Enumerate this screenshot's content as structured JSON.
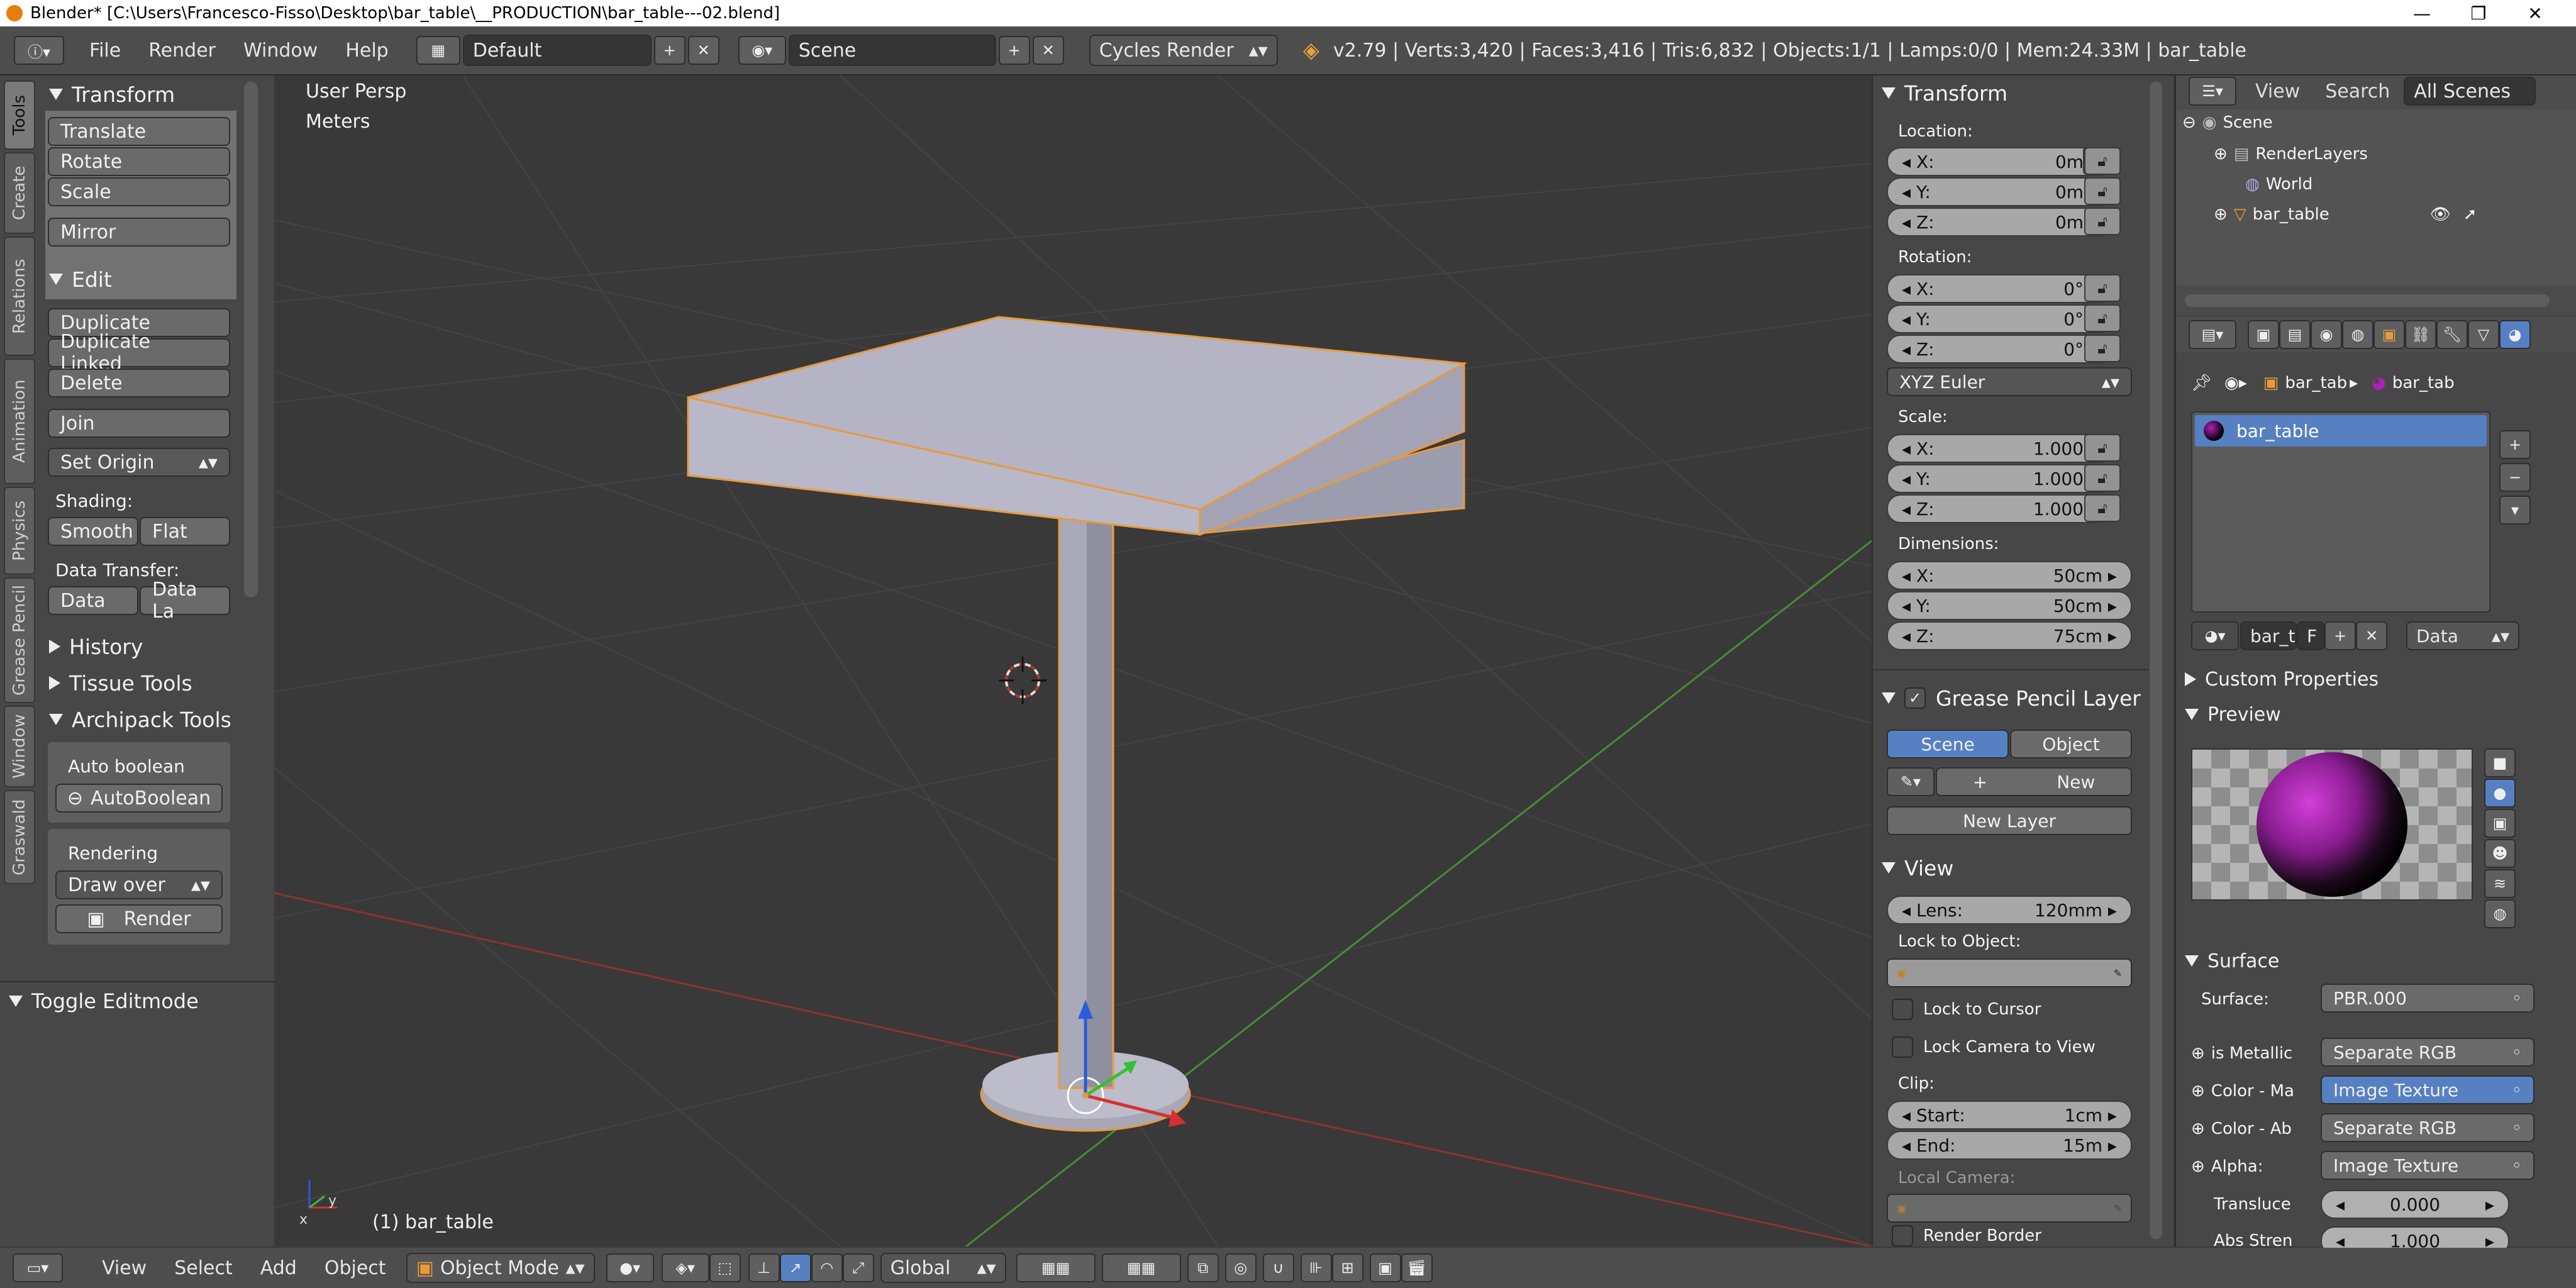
{
  "titlebar": {
    "title": "Blender* [C:\\Users\\Francesco-Fisso\\Desktop\\bar_table\\__PRODUCTION\\bar_table---02.blend]"
  },
  "topbar": {
    "menus": [
      "File",
      "Render",
      "Window",
      "Help"
    ],
    "layout": "Default",
    "scene": "Scene",
    "engine": "Cycles Render",
    "stats": "v2.79 | Verts:3,420 | Faces:3,416 | Tris:6,832 | Objects:1/1 | Lamps:0/0 | Mem:24.33M | bar_table"
  },
  "toolshelf": {
    "tabs": [
      "Tools",
      "Create",
      "Relations",
      "Animation",
      "Physics",
      "Grease Pencil",
      "Window",
      "Graswald"
    ],
    "transform_title": "Transform",
    "translate": "Translate",
    "rotate": "Rotate",
    "scale": "Scale",
    "mirror": "Mirror",
    "edit_title": "Edit",
    "duplicate": "Duplicate",
    "duplicate_linked": "Duplicate Linked",
    "delete": "Delete",
    "join": "Join",
    "set_origin": "Set Origin",
    "shading_label": "Shading:",
    "smooth": "Smooth",
    "flat": "Flat",
    "data_transfer_label": "Data Transfer:",
    "data": "Data",
    "data_la": "Data La",
    "history": "History",
    "tissue_tools": "Tissue Tools",
    "archipack_tools": "Archipack Tools",
    "auto_boolean_label": "Auto boolean",
    "auto_boolean_btn": "AutoBoolean",
    "rendering_label": "Rendering",
    "draw_over": "Draw over",
    "render_btn": "Render",
    "toggle_editmode": "Toggle Editmode"
  },
  "viewport": {
    "view_name": "User Persp",
    "units": "Meters",
    "object_label": "(1) bar_table"
  },
  "properties": {
    "transform_title": "Transform",
    "location_label": "Location:",
    "loc_x": "0m",
    "loc_y": "0m",
    "loc_z": "0m",
    "rotation_label": "Rotation:",
    "rot_x": "0°",
    "rot_y": "0°",
    "rot_z": "0°",
    "rotation_mode": "XYZ Euler",
    "scale_label": "Scale:",
    "scl_x": "1.000",
    "scl_y": "1.000",
    "scl_z": "1.000",
    "dimensions_label": "Dimensions:",
    "dim_x": "50cm",
    "dim_y": "50cm",
    "dim_z": "75cm",
    "axis_x": "X:",
    "axis_y": "Y:",
    "axis_z": "Z:",
    "grease_pencil_title": "Grease Pencil Layer",
    "gp_scene": "Scene",
    "gp_object": "Object",
    "gp_new": "New",
    "gp_new_layer": "New Layer",
    "view_title": "View",
    "lens_label": "Lens:",
    "lens_value": "120mm",
    "lock_to_object": "Lock to Object:",
    "lock_to_cursor": "Lock to Cursor",
    "lock_camera": "Lock Camera to View",
    "clip_label": "Clip:",
    "clip_start_label": "Start:",
    "clip_start": "1cm",
    "clip_end_label": "End:",
    "clip_end": "15m",
    "local_camera": "Local Camera:",
    "render_border": "Render Border"
  },
  "outliner": {
    "view": "View",
    "search": "Search",
    "all_scenes": "All Scenes",
    "items": [
      "Scene",
      "RenderLayers",
      "World",
      "bar_table"
    ]
  },
  "material": {
    "crumb_1": "bar_tab",
    "crumb_2": "bar_tab",
    "slot": "bar_table",
    "datablock": "bar_t",
    "f": "F",
    "data_dropdown": "Data",
    "custom_properties": "Custom Properties",
    "preview": "Preview",
    "surface_title": "Surface",
    "surface_label": "Surface:",
    "surface_value": "PBR.000",
    "rows": [
      {
        "label": "is Metallic",
        "value": "Separate RGB"
      },
      {
        "label": "Color - Ma",
        "value": "Image Texture"
      },
      {
        "label": "Color - Ab",
        "value": "Separate RGB"
      },
      {
        "label": "Alpha:",
        "value": "Image Texture"
      }
    ],
    "transluce_label": "Transluce",
    "transluce_value": "0.000",
    "abs_label": "Abs Stren",
    "abs_value": "1.000"
  },
  "bottombar": {
    "view": "View",
    "select": "Select",
    "add": "Add",
    "object": "Object",
    "mode": "Object Mode",
    "orientation": "Global"
  },
  "colors": {
    "accent_blue": "#5680c2",
    "selection_orange": "#e89a3a",
    "material_magenta": "#b020b8"
  }
}
